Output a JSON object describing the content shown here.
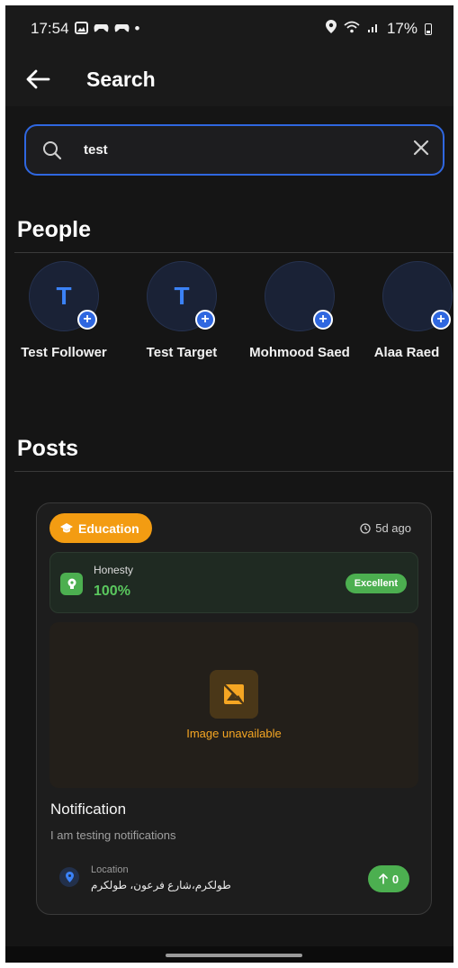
{
  "status_bar": {
    "time": "17:54",
    "battery": "17%",
    "dot": "•",
    "left_icons": [
      "image-icon",
      "game-controller-icon",
      "game-controller-icon"
    ],
    "right_icons": [
      "location-pin-icon",
      "wifi-icon",
      "signal-icon",
      "battery-icon"
    ]
  },
  "app_bar": {
    "title": "Search",
    "back_icon": "arrow-left-icon"
  },
  "search": {
    "value": "test",
    "icon": "search-icon",
    "clear_icon": "close-icon",
    "accent_color": "#2f67e0"
  },
  "people": {
    "title": "People",
    "items": [
      {
        "name": "Test Follower",
        "initial": "T"
      },
      {
        "name": "Test Target",
        "initial": "T"
      },
      {
        "name": "Mohmood Saed",
        "initial": ""
      },
      {
        "name": "Alaa Raed",
        "initial": ""
      }
    ]
  },
  "posts": {
    "title": "Posts",
    "items": [
      {
        "category": "Education",
        "category_icon": "graduation-cap-icon",
        "category_color": "#f39c12",
        "time": "5d ago",
        "time_icon": "clock-icon",
        "honesty_label": "Honesty",
        "honesty_value": "100%",
        "honesty_icon": "lightbulb-icon",
        "rating": "Excellent",
        "rating_color": "#4caf50",
        "image_placeholder": "Image unavailable",
        "image_icon": "broken-image-icon",
        "title": "Notification",
        "body": "I am testing notifications",
        "location_label": "Location",
        "location_value": "طولكرم،شارع فرعون، طولكرم",
        "location_icon": "location-pin-icon",
        "votes": "0",
        "vote_icon": "arrow-up-icon"
      }
    ]
  }
}
